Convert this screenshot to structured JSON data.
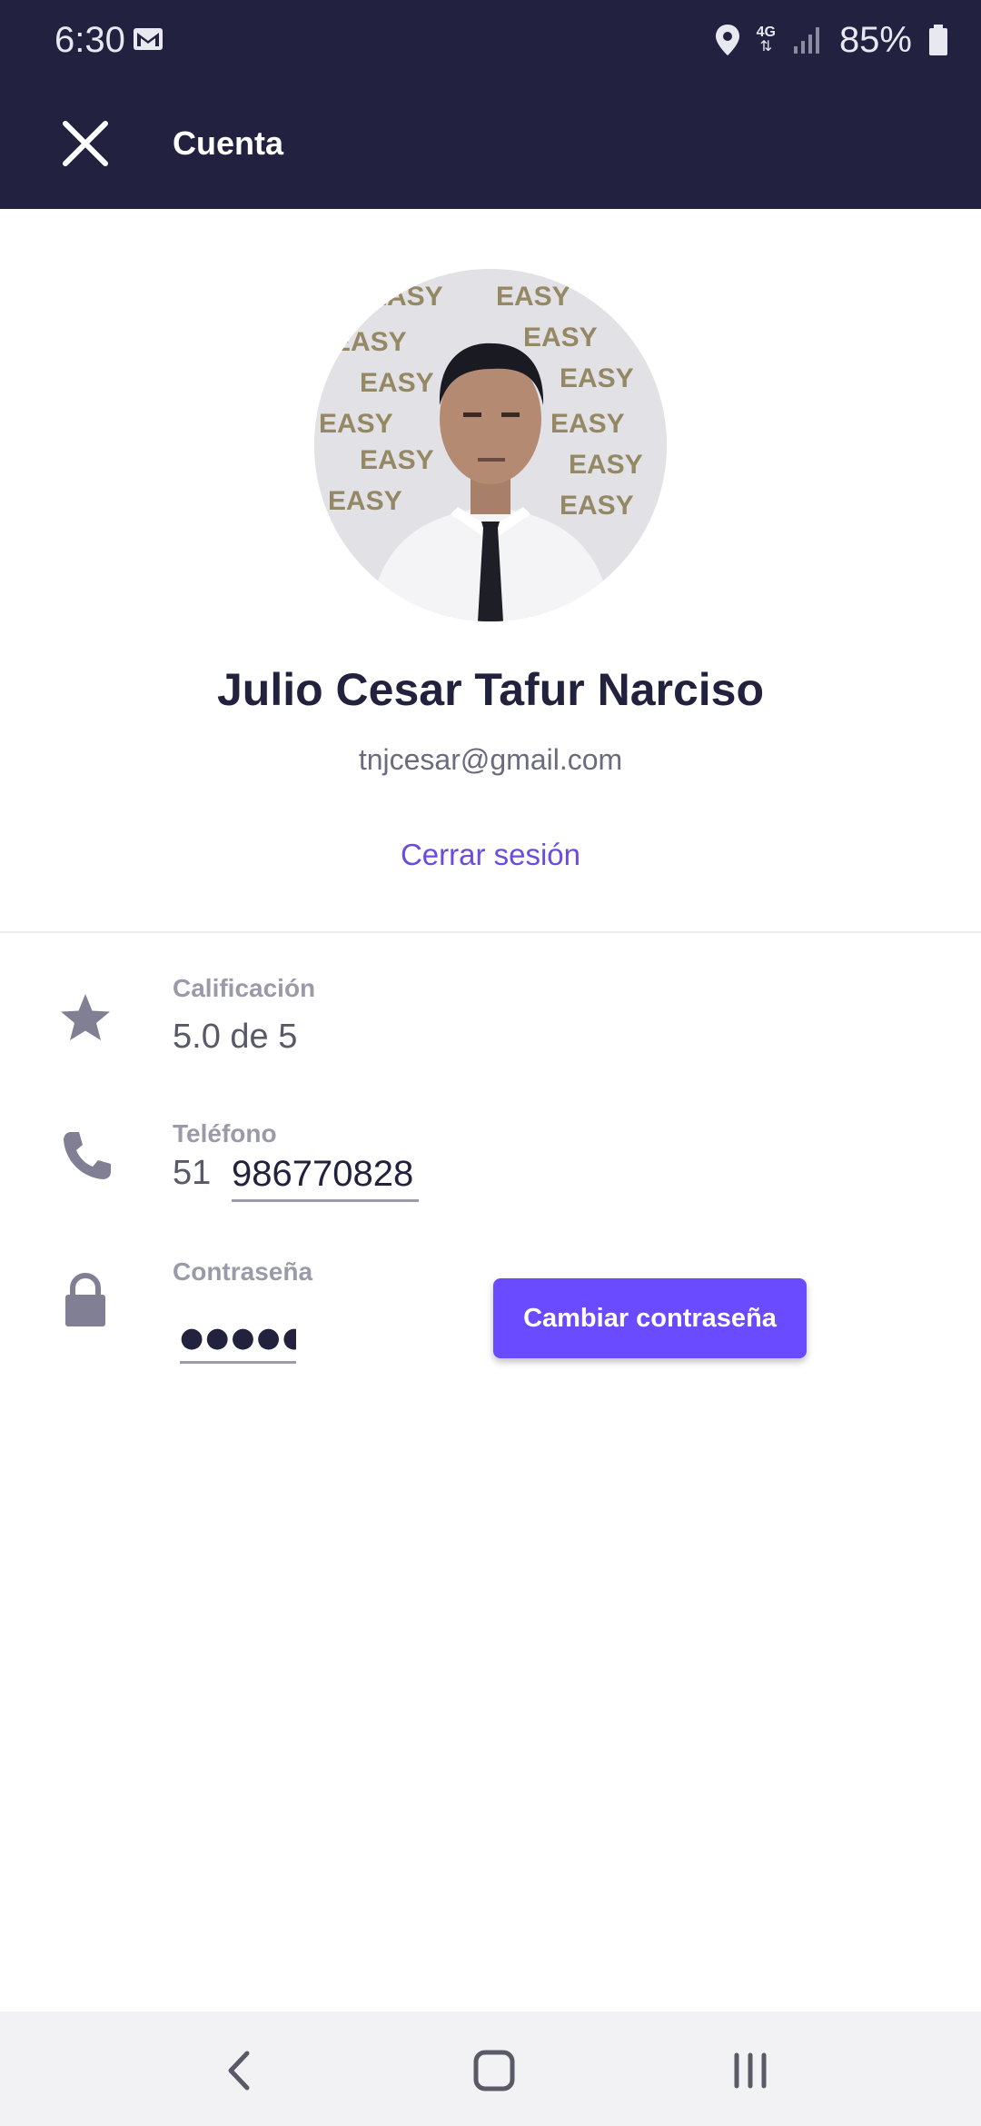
{
  "status_bar": {
    "time": "6:30",
    "network": "4G",
    "battery": "85%",
    "icons": [
      "mail-icon",
      "location-icon",
      "signal-icon",
      "battery-icon"
    ]
  },
  "app_bar": {
    "title": "Cuenta",
    "close_icon": "close-icon"
  },
  "profile": {
    "name": "Julio Cesar Tafur Narciso",
    "email": "tnjcesar@gmail.com",
    "logout_label": "Cerrar sesión",
    "avatar_bg_text": "EASY"
  },
  "rating": {
    "label": "Calificación",
    "value": "5.0 de 5",
    "icon": "star-icon"
  },
  "phone": {
    "label": "Teléfono",
    "prefix": "51",
    "number": "986770828",
    "icon": "phone-icon"
  },
  "password": {
    "label": "Contraseña",
    "masked": "●●●●●●",
    "button_label": "Cambiar contraseña",
    "icon": "lock-icon"
  },
  "colors": {
    "header_bg": "#222240",
    "accent": "#6b4bff",
    "link": "#6b4be0"
  },
  "nav": [
    "back-icon",
    "home-icon",
    "recents-icon"
  ]
}
